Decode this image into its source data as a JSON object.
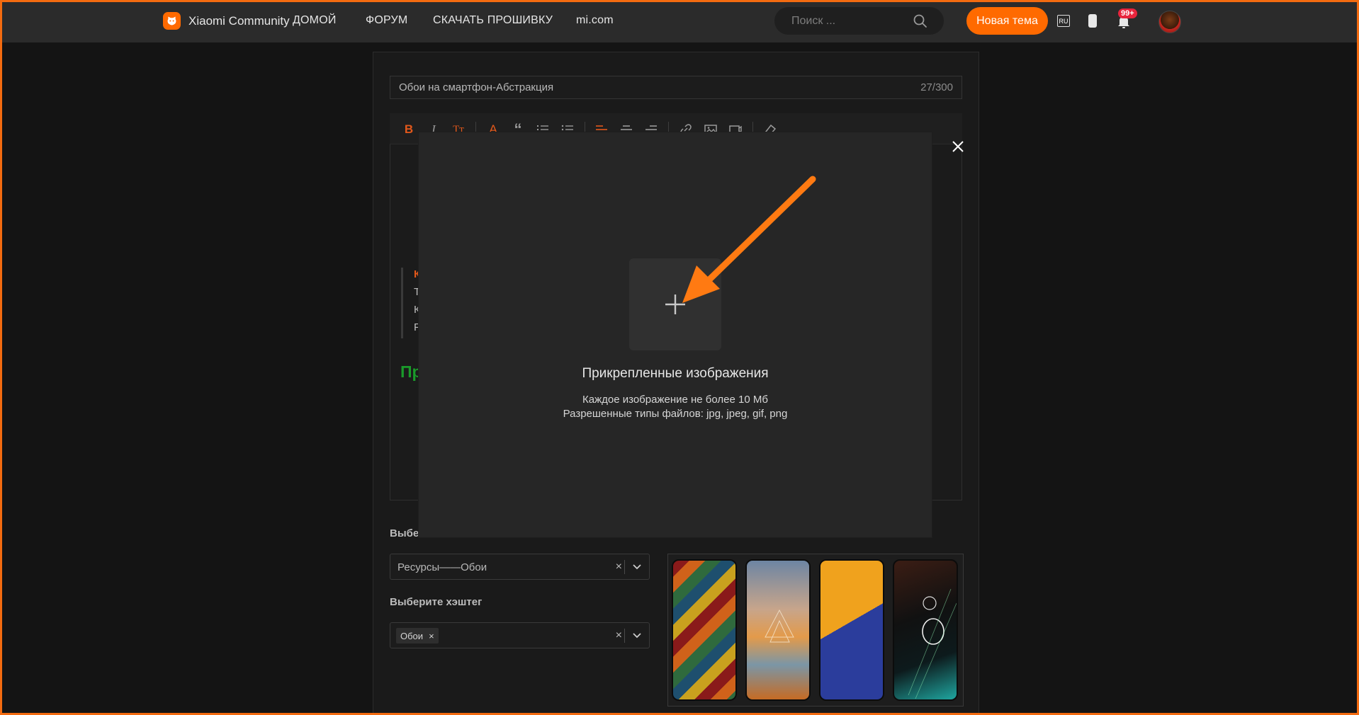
{
  "header": {
    "brand": "Xiaomi Community",
    "nav": [
      "ДОМОЙ",
      "ФОРУМ",
      "СКАЧАТЬ ПРОШИВКУ",
      "mi.com"
    ],
    "search_placeholder": "Поиск ...",
    "new_topic": "Новая тема",
    "lang": "RU",
    "notifications_badge": "99+"
  },
  "editor": {
    "title_value": "Обои на смартфон-Абстракция",
    "title_counter": "27/300",
    "partial_lines": [
      "К",
      "Т",
      "К",
      "Р"
    ],
    "green_text": "Пр"
  },
  "form": {
    "category_label": "Выбе",
    "category_value": "Ресурсы——Обои",
    "hashtag_label": "Выберите хэштег",
    "hashtag_tag": "Обои",
    "clear_symbol": "×"
  },
  "modal": {
    "title": "Прикрепленные изображения",
    "note_size": "Каждое изображение не более 10 Мб",
    "note_types": "Разрешенные типы файлов: jpg, jpeg, gif, png"
  },
  "colors": {
    "accent": "#ff6a00",
    "background": "#141414",
    "modal": "#262626"
  }
}
